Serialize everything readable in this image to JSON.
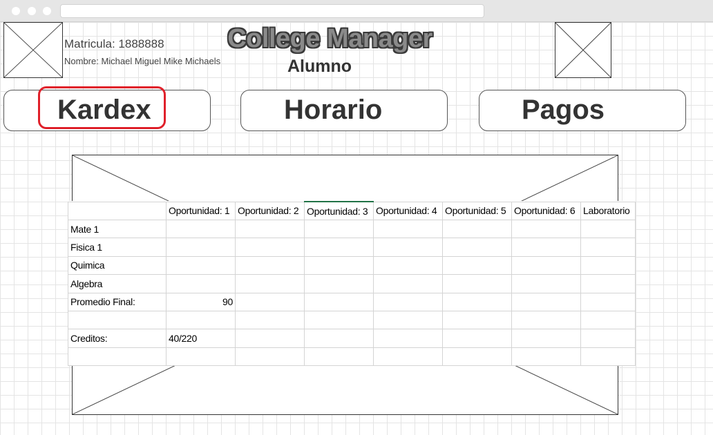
{
  "header": {
    "matricula": "Matricula: 1888888",
    "nombre": "Nombre: Michael Miguel Mike Michaels",
    "app_title": "College Manager",
    "subtitle": "Alumno"
  },
  "nav": {
    "kardex": "Kardex",
    "horario": "Horario",
    "pagos": "Pagos",
    "selected": "Kardex"
  },
  "kardex_table": {
    "columns": [
      "",
      "Oportunidad: 1",
      "Oportunidad: 2",
      "Oportunidad: 3",
      "Oportunidad: 4",
      "Oportunidad: 5",
      "Oportunidad: 6",
      "Laboratorio"
    ],
    "rows": [
      [
        "Mate 1",
        "",
        "",
        "",
        "",
        "",
        "",
        ""
      ],
      [
        "Fisica 1",
        "",
        "",
        "",
        "",
        "",
        "",
        ""
      ],
      [
        "Quimica",
        "",
        "",
        "",
        "",
        "",
        "",
        ""
      ],
      [
        "Algebra",
        "",
        "",
        "",
        "",
        "",
        "",
        ""
      ],
      [
        "Promedio Final:",
        "90",
        "",
        "",
        "",
        "",
        "",
        ""
      ],
      [
        "",
        "",
        "",
        "",
        "",
        "",
        "",
        ""
      ],
      [
        "Creditos:",
        "40/220",
        "",
        "",
        "",
        "",
        "",
        ""
      ],
      [
        "",
        "",
        "",
        "",
        "",
        "",
        "",
        ""
      ]
    ]
  },
  "colors": {
    "highlight": "#e0202a",
    "active_column": "#217346"
  }
}
